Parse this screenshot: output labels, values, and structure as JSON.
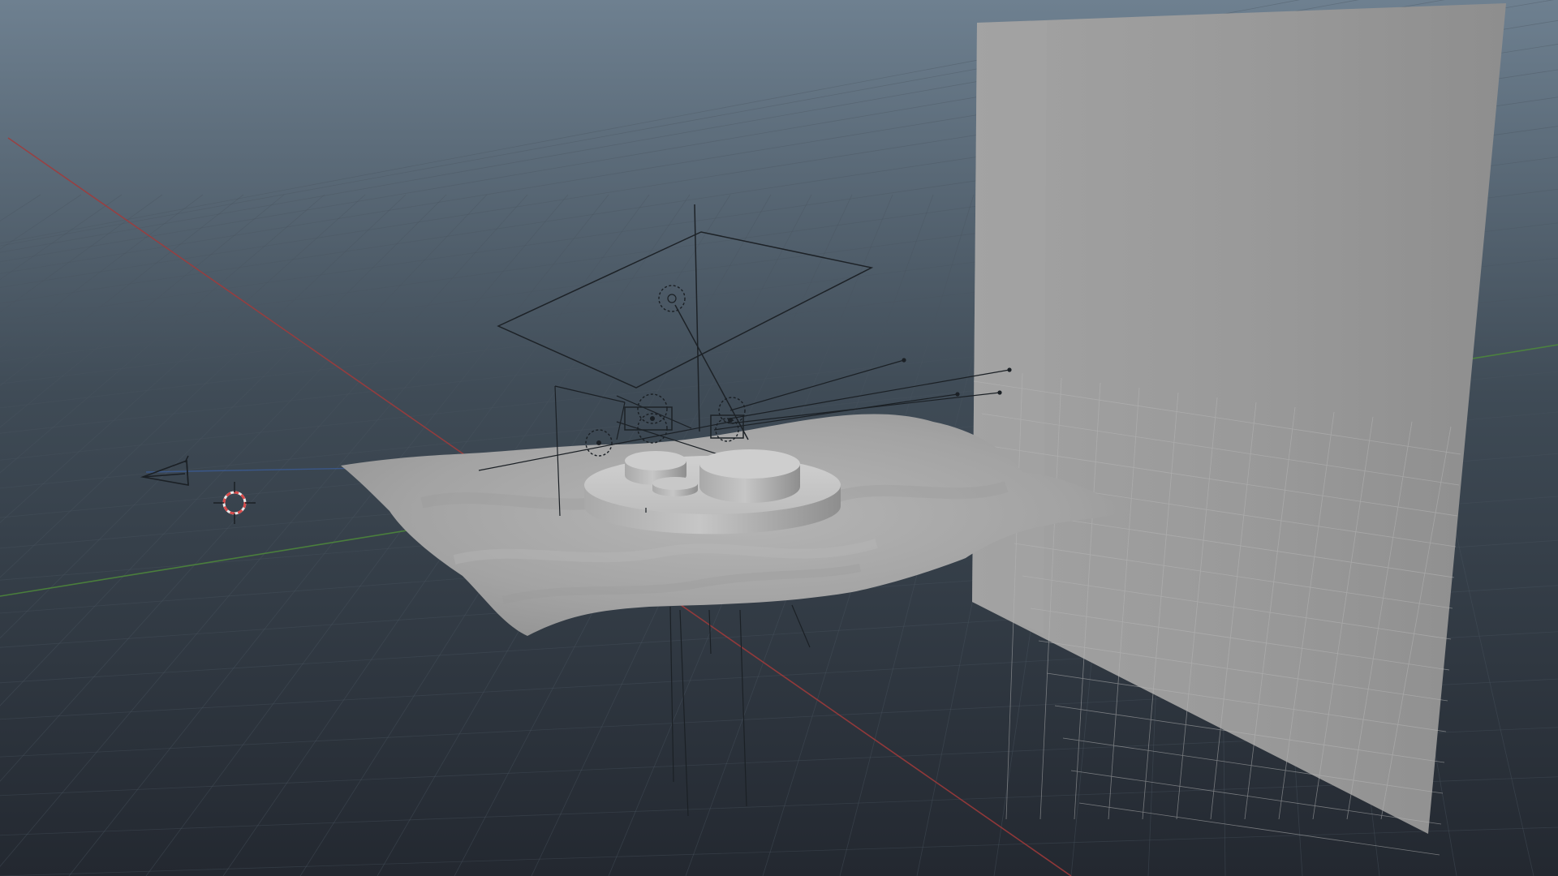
{
  "app": {
    "type": "3d-perspective-viewport"
  },
  "viewport": {
    "background_top": "#6e8090",
    "background_bottom": "#252a30",
    "grid_color": "#4a5560",
    "x_axis_color": "#b03a3a",
    "z_axis_color": "#4e8a3a",
    "y_axis_color": "#3b5fa0"
  },
  "scene": {
    "objects": [
      {
        "name": "backdrop-wall",
        "kind": "plane",
        "color": "#9a9a9a"
      },
      {
        "name": "ground-terrain",
        "kind": "deformed-plane",
        "color": "#a8a8a8"
      },
      {
        "name": "platform-base",
        "kind": "cylinder",
        "color": "#bcbcbc"
      },
      {
        "name": "small-cylinder-left",
        "kind": "cylinder",
        "color": "#c4c4c4"
      },
      {
        "name": "large-cylinder-right",
        "kind": "cylinder",
        "color": "#c4c4c4"
      },
      {
        "name": "small-puck",
        "kind": "cylinder",
        "color": "#c2c2c2"
      }
    ],
    "helpers": [
      {
        "name": "scene-camera",
        "icon": "camera-icon"
      },
      {
        "name": "locator-target",
        "icon": "crosshair-icon",
        "accent": "#d84a4a"
      },
      {
        "name": "area-light",
        "icon": "area-light-icon"
      },
      {
        "name": "light-rig",
        "icon": "spot-light-icon"
      }
    ]
  }
}
